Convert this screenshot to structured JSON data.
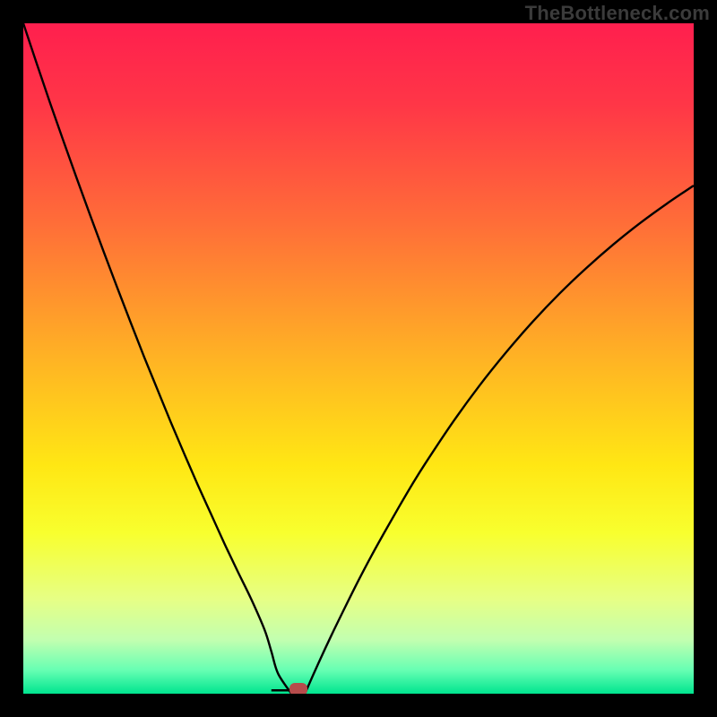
{
  "watermark": "TheBottleneck.com",
  "chart_data": {
    "type": "line",
    "title": "",
    "xlabel": "",
    "ylabel": "",
    "x_range": [
      0,
      100
    ],
    "y_range": [
      0,
      100
    ],
    "minimum_x": 40,
    "marker": {
      "x": 41,
      "y": 0,
      "color": "#b64b4b"
    },
    "background_gradient_stops": [
      {
        "pos": 0.0,
        "color": "#ff1f4e"
      },
      {
        "pos": 0.12,
        "color": "#ff3647"
      },
      {
        "pos": 0.3,
        "color": "#ff6e38"
      },
      {
        "pos": 0.5,
        "color": "#ffb324"
      },
      {
        "pos": 0.66,
        "color": "#ffe714"
      },
      {
        "pos": 0.76,
        "color": "#f8ff2e"
      },
      {
        "pos": 0.86,
        "color": "#e6ff86"
      },
      {
        "pos": 0.92,
        "color": "#c2ffb0"
      },
      {
        "pos": 0.965,
        "color": "#66ffb3"
      },
      {
        "pos": 1.0,
        "color": "#00e58f"
      }
    ],
    "series": [
      {
        "name": "left-branch",
        "x": [
          0,
          2,
          4,
          6,
          8,
          10,
          12,
          14,
          16,
          18,
          20,
          22,
          24,
          26,
          28,
          30,
          32,
          34,
          36,
          37,
          38,
          40
        ],
        "y": [
          100,
          94.0,
          88.1,
          82.4,
          76.8,
          71.3,
          65.9,
          60.6,
          55.4,
          50.3,
          45.4,
          40.5,
          35.8,
          31.2,
          26.8,
          22.4,
          18.2,
          14.1,
          9.5,
          6.3,
          3.0,
          0.0
        ]
      },
      {
        "name": "flat",
        "x": [
          37,
          42
        ],
        "y": [
          0.5,
          0.5
        ]
      },
      {
        "name": "right-branch",
        "x": [
          42,
          44,
          46,
          48,
          50,
          52,
          54,
          56,
          58,
          60,
          64,
          68,
          72,
          76,
          80,
          84,
          88,
          92,
          96,
          100
        ],
        "y": [
          0.0,
          4.5,
          8.8,
          12.9,
          16.9,
          20.7,
          24.3,
          27.8,
          31.2,
          34.4,
          40.4,
          45.9,
          50.9,
          55.5,
          59.7,
          63.5,
          67.0,
          70.2,
          73.1,
          75.8
        ]
      }
    ],
    "axes_visible": false,
    "grid": false
  }
}
